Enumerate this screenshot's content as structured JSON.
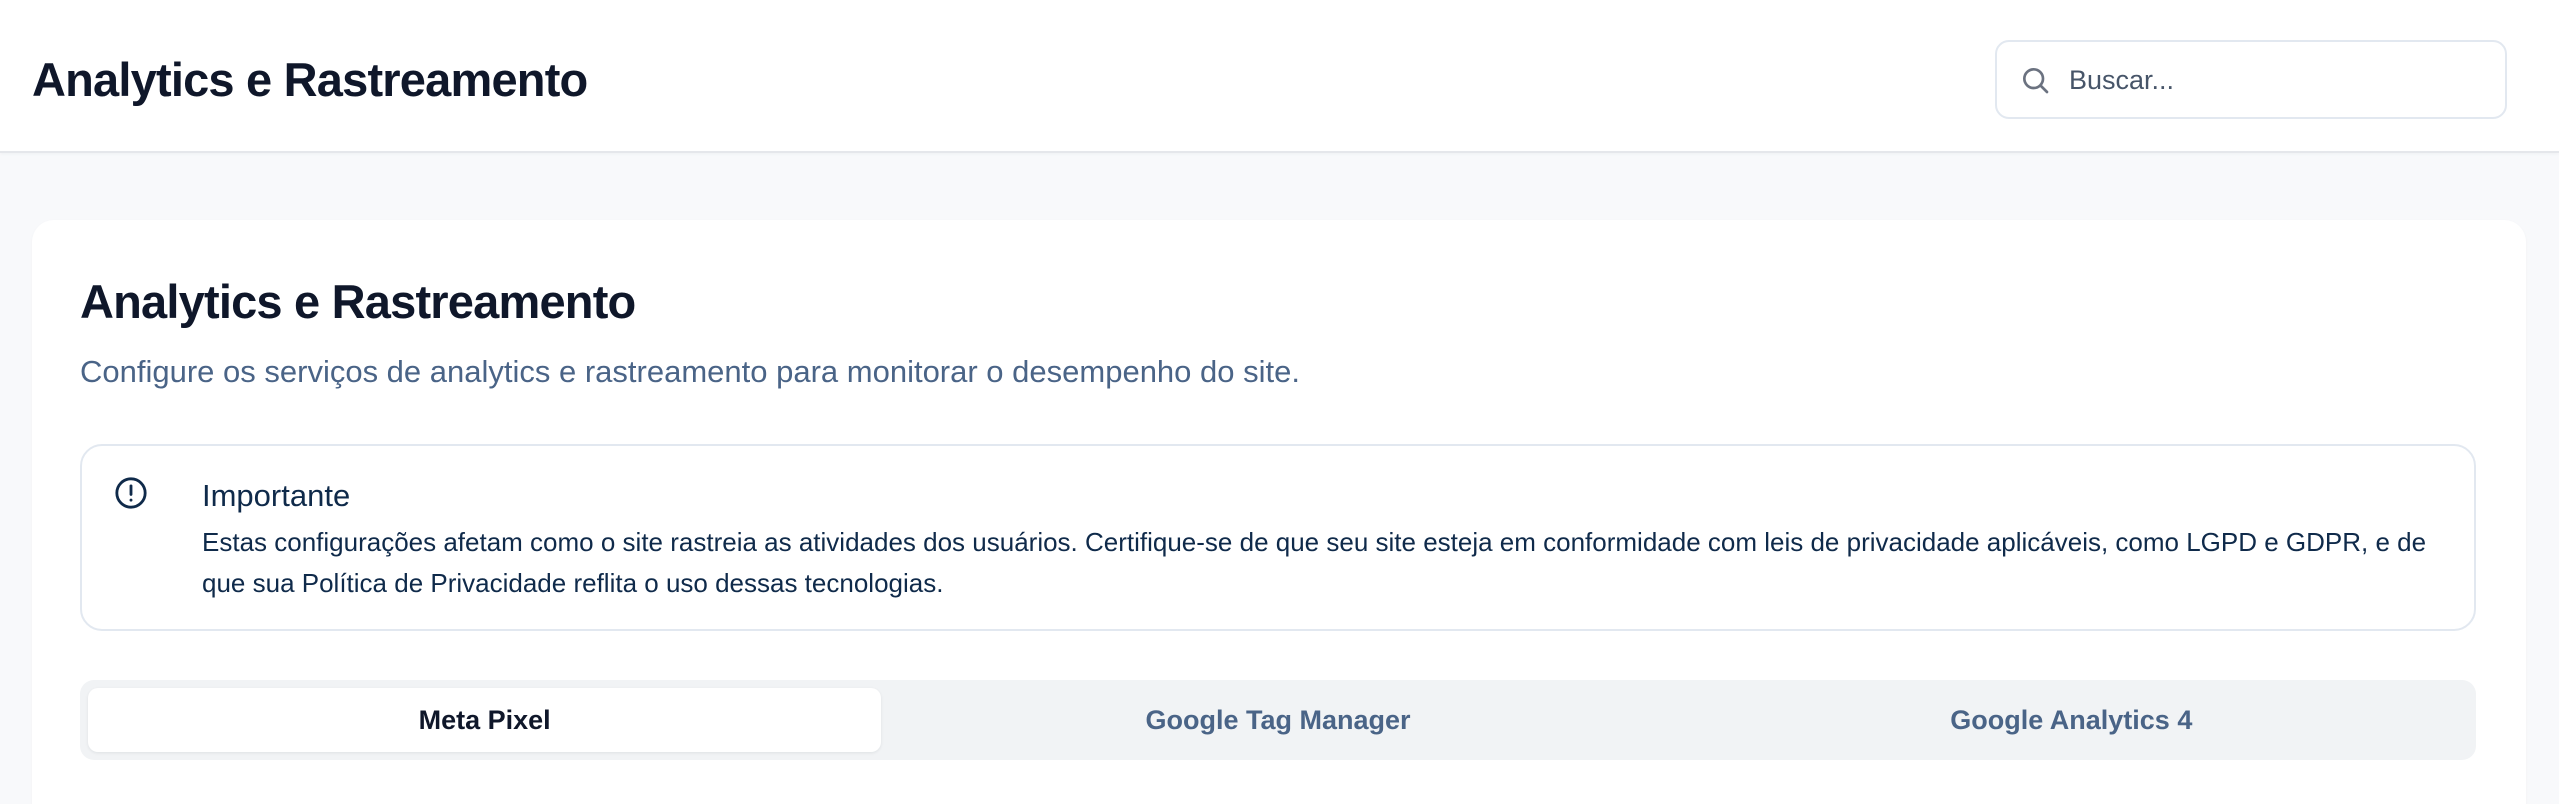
{
  "header": {
    "title": "Analytics e Rastreamento",
    "search": {
      "placeholder": "Buscar...",
      "value": ""
    }
  },
  "main": {
    "title": "Analytics e Rastreamento",
    "subtitle": "Configure os serviços de analytics e rastreamento para monitorar o desempenho do site.",
    "alert": {
      "icon": "alert-circle-icon",
      "title": "Importante",
      "text": "Estas configurações afetam como o site rastreia as atividades dos usuários. Certifique-se de que seu site esteja em conformidade com leis de privacidade aplicáveis, como LGPD e GDPR, e de que sua Política de Privacidade reflita o uso dessas tecnologias."
    },
    "tabs": [
      {
        "label": "Meta Pixel",
        "active": true
      },
      {
        "label": "Google Tag Manager",
        "active": false
      },
      {
        "label": "Google Analytics 4",
        "active": false
      }
    ]
  },
  "colors": {
    "background": "#f8f9fb",
    "text_primary": "#0f172a",
    "text_secondary": "#4a6487",
    "tab_bar": "#f1f3f5"
  }
}
